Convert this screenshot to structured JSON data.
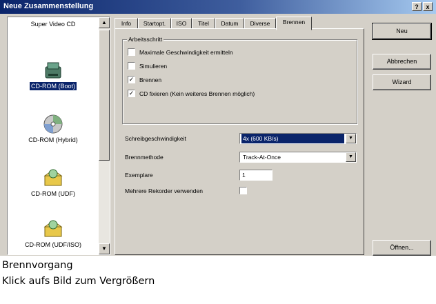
{
  "window": {
    "title": "Neue Zusammenstellung",
    "help_label": "?",
    "close_label": "x"
  },
  "left_list": {
    "items": [
      {
        "label": "Super Video CD",
        "icon": "video-cd-icon",
        "selected": false
      },
      {
        "label": "CD-ROM (Boot)",
        "icon": "cdrom-boot-icon",
        "selected": true
      },
      {
        "label": "CD-ROM (Hybrid)",
        "icon": "cdrom-hybrid-icon",
        "selected": false
      },
      {
        "label": "CD-ROM (UDF)",
        "icon": "cdrom-udf-icon",
        "selected": false
      },
      {
        "label": "CD-ROM (UDF/ISO)",
        "icon": "cdrom-udf-iso-icon",
        "selected": false
      }
    ],
    "scroll_up": "▲",
    "scroll_down": "▼"
  },
  "tabs": [
    {
      "label": "Info"
    },
    {
      "label": "Startopt."
    },
    {
      "label": "ISO"
    },
    {
      "label": "Titel"
    },
    {
      "label": "Datum"
    },
    {
      "label": "Diverse"
    },
    {
      "label": "Brennen",
      "active": true
    }
  ],
  "action_group": {
    "title": "Arbeitsschritt",
    "options": [
      {
        "label": "Maximale Geschwindigkeit ermitteln",
        "checked": false
      },
      {
        "label": "Simulieren",
        "checked": false
      },
      {
        "label": "Brennen",
        "checked": true
      },
      {
        "label": "CD fixieren (Kein weiteres Brennen möglich)",
        "checked": true
      }
    ]
  },
  "settings": {
    "speed_label": "Schreibgeschwindigkeit",
    "speed_value": "4x (600 KB/s)",
    "method_label": "Brennmethode",
    "method_value": "Track-At-Once",
    "copies_label": "Exemplare",
    "copies_value": "1",
    "multi_label": "Mehrere Rekorder verwenden",
    "multi_checked": false,
    "arrow": "▼"
  },
  "buttons": {
    "new": "Neu",
    "cancel": "Abbrechen",
    "wizard": "Wizard",
    "open": "Öffnen..."
  },
  "caption": {
    "line1": "Brennvorgang",
    "line2": "Klick aufs Bild zum Vergrößern"
  },
  "colors": {
    "title_bar": "#0a246a",
    "selection": "#0a246a",
    "face": "#d4d0c8"
  }
}
